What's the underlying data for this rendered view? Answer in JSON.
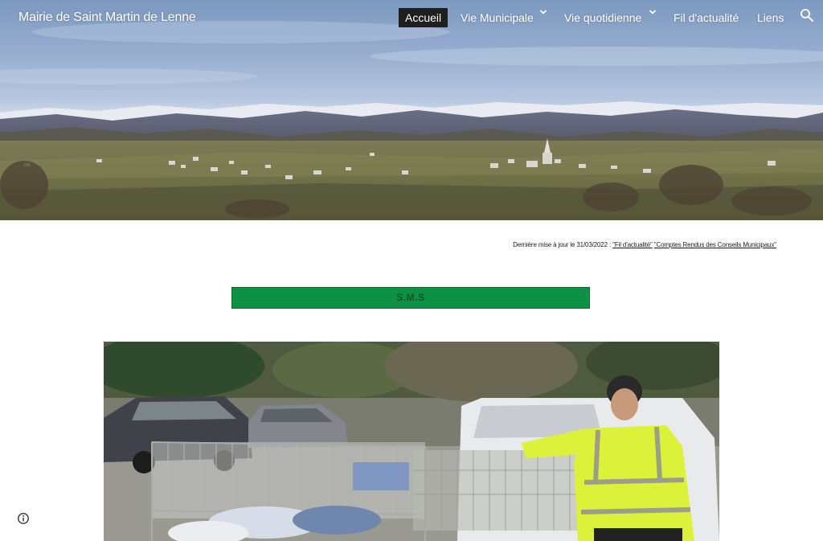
{
  "header": {
    "site_title": "Mairie de Saint Martin de Lenne",
    "nav": [
      {
        "label": "Accueil",
        "active": true,
        "has_dropdown": false
      },
      {
        "label": "Vie Municipale",
        "active": false,
        "has_dropdown": true
      },
      {
        "label": "Vie quotidienne",
        "active": false,
        "has_dropdown": true
      },
      {
        "label": "Fil d'actualité",
        "active": false,
        "has_dropdown": false
      },
      {
        "label": "Liens",
        "active": false,
        "has_dropdown": false
      }
    ],
    "search_icon": "search-icon",
    "chevron_icon": "chevron-down-icon"
  },
  "main": {
    "update_prefix": "Dernière mise à jour le 31/03/2022 :",
    "update_link_1": "\"Fil d'actualité\"",
    "update_link_2": "\"Comptes Rendus des Conseils Municipaux\"",
    "sms_button_label": "S.M.S",
    "photo_icon": "photo"
  },
  "footer": {
    "info_icon": "info-icon"
  },
  "colors": {
    "accent_green": "#0d9145",
    "nav_active_bg": "#1f1f1f",
    "text_dark": "#1b1b1b"
  }
}
